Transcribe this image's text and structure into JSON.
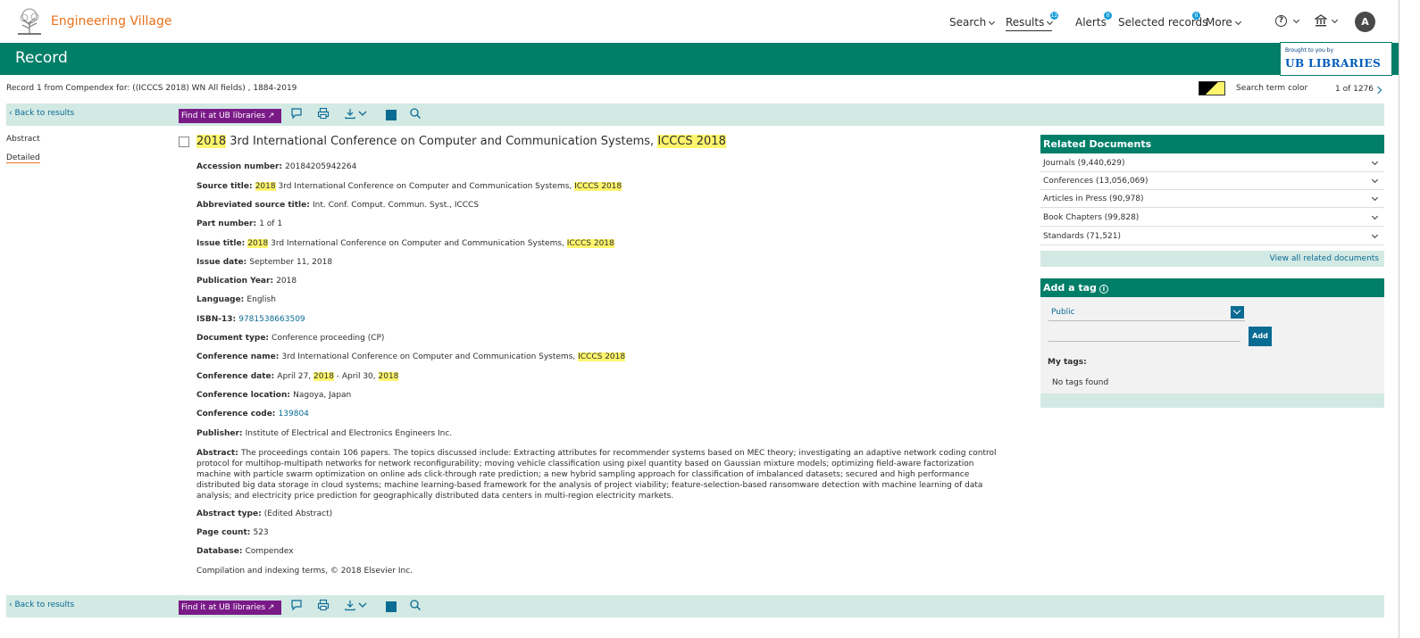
{
  "header": {
    "brand": "Engineering Village",
    "nav": [
      {
        "label": "Search",
        "key": "search"
      },
      {
        "label": "Results",
        "key": "results",
        "badge": "12"
      },
      {
        "label": "Alerts",
        "key": "alerts",
        "badge": "0"
      },
      {
        "label": "Selected records",
        "key": "selected",
        "badge": "0"
      },
      {
        "label": "More",
        "key": "more"
      }
    ],
    "help": "?",
    "avatar_initial": "A"
  },
  "record_bar": {
    "title": "Record",
    "brought_by": "Brought to you by",
    "ub_logo": "LIBRARIES",
    "ub_mark": "UB"
  },
  "subheader": {
    "record_from": "Record 1 from Compendex for: ((ICCCS 2018) WN All fields) , 1884-2019",
    "search_term_color": "Search term color",
    "pager": "1 of 1276"
  },
  "toolbar": {
    "back": "Back to results",
    "find_it": "Find it at UB libraries ↗"
  },
  "leftnav": {
    "abstract": "Abstract",
    "detailed": "Detailed"
  },
  "record": {
    "title_year": "2018",
    "title_mid": " 3rd International Conference on Computer and Communication Systems, ",
    "title_hl": "ICCCS 2018",
    "accession_label": "Accession number: ",
    "accession": "20184205942264",
    "source_label": "Source title: ",
    "source_year": "2018",
    "source_mid": " 3rd International Conference on Computer and Communication Systems, ",
    "source_hl": "ICCCS 2018",
    "abbrev_label": "Abbreviated source title: ",
    "abbrev": "Int. Conf. Comput. Commun. Syst., ICCCS",
    "part_label": "Part number: ",
    "part": "1 of 1",
    "issue_title_label": "Issue title: ",
    "issue_year": "2018",
    "issue_mid": " 3rd International Conference on Computer and Communication Systems, ",
    "issue_hl": "ICCCS 2018",
    "issue_date_label": "Issue date: ",
    "issue_date": "September 11, 2018",
    "pub_year_label": "Publication Year: ",
    "pub_year": "2018",
    "language_label": "Language: ",
    "language": "English",
    "isbn_label": "ISBN-13: ",
    "isbn": "9781538663509",
    "doctype_label": "Document type: ",
    "doctype": "Conference proceeding (CP)",
    "confname_label": "Conference name: ",
    "confname": "3rd International Conference on Computer and Communication Systems, ",
    "confname_hl": "ICCCS 2018",
    "confdate_label": "Conference date: ",
    "confdate_a": "April 27, ",
    "confdate_hl1": "2018",
    "confdate_b": " - April 30, ",
    "confdate_hl2": "2018",
    "confloc_label": "Conference location: ",
    "confloc": "Nagoya, Japan",
    "confcode_label": "Conference code: ",
    "confcode": "139804",
    "publisher_label": "Publisher: ",
    "publisher": "Institute of Electrical and Electronics Engineers Inc.",
    "abstract_label": "Abstract: ",
    "abstract": "The proceedings contain 106 papers. The topics discussed include: Extracting attributes for recommender systems based on MEC theory; investigating an adaptive network coding control protocol for multihop-multipath networks for network reconfigurability; moving vehicle classification using pixel quantity based on Gaussian mixture models; optimizing field-aware factorization machine with particle swarm optimization on online ads click-through rate prediction; a new hybrid sampling approach for classification of imbalanced datasets; secured and high performance distributed big data storage in cloud systems; machine learning-based framework for the analysis of project viability; feature-selection-based ransomware detection with machine learning of data analysis; and electricity price prediction for geographically distributed data centers in multi-region electricity markets.",
    "abstract_type_label": "Abstract type: ",
    "abstract_type": "(Edited Abstract)",
    "page_count_label": "Page count: ",
    "page_count": "523",
    "database_label": "Database: ",
    "database": "Compendex",
    "copyright": "Compilation and indexing terms, © 2018 Elsevier Inc."
  },
  "related": {
    "title": "Related Documents",
    "items": [
      "Journals (9,440,629)",
      "Conferences (13,056,069)",
      "Articles in Press (90,978)",
      "Book Chapters (99,828)",
      "Standards (71,521)"
    ],
    "view_all": "View all related documents"
  },
  "tags": {
    "title": "Add a tag",
    "visibility": "Public",
    "add": "Add",
    "my_tags": "My tags:",
    "no_tags": "No tags found"
  },
  "colors": {
    "brand": "#e9711c",
    "green": "#007e68",
    "light_green": "#d3e9e4",
    "link": "#0a6b93",
    "purple": "#7a1a87",
    "highlight": "#fff56d"
  }
}
